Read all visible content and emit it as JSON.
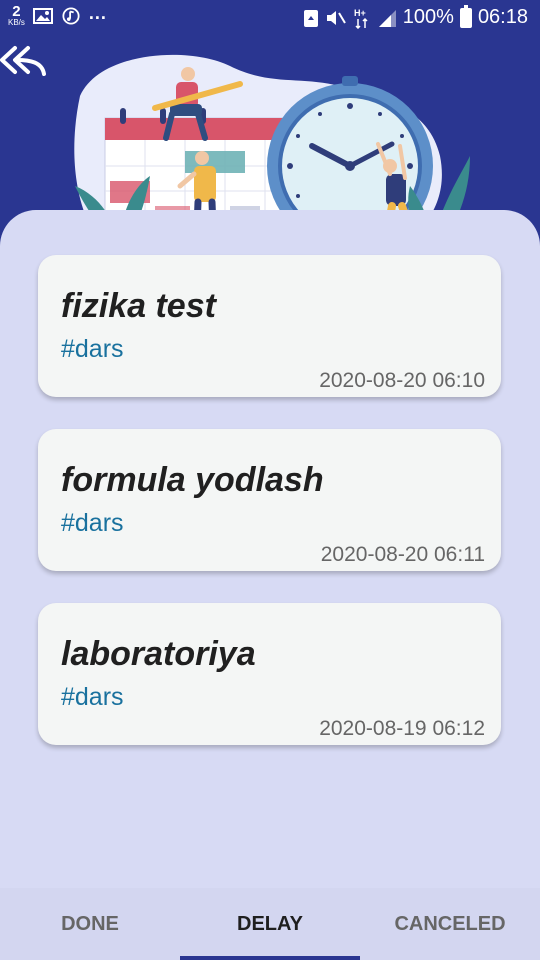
{
  "status_bar": {
    "net_speed": "2",
    "net_unit": "KB/s",
    "more": "...",
    "battery": "100%",
    "time": "06:18",
    "network": "H+"
  },
  "header": {
    "back_icon": "double-back-arrow-icon",
    "illustration": "people-calendar-clock-illustration"
  },
  "tasks": [
    {
      "title": "fizika test",
      "tag": "#dars",
      "date": "2020-08-20 06:10"
    },
    {
      "title": "formula yodlash",
      "tag": "#dars",
      "date": "2020-08-20 06:11"
    },
    {
      "title": "laboratoriya",
      "tag": "#dars",
      "date": "2020-08-19 06:12"
    }
  ],
  "tabs": [
    {
      "label": "DONE",
      "active": false
    },
    {
      "label": "DELAY",
      "active": true
    },
    {
      "label": "CANCELED",
      "active": false
    }
  ],
  "colors": {
    "primary": "#2a3691",
    "background": "#d7daf4",
    "card": "#f4f6f5",
    "tag": "#19719e"
  }
}
